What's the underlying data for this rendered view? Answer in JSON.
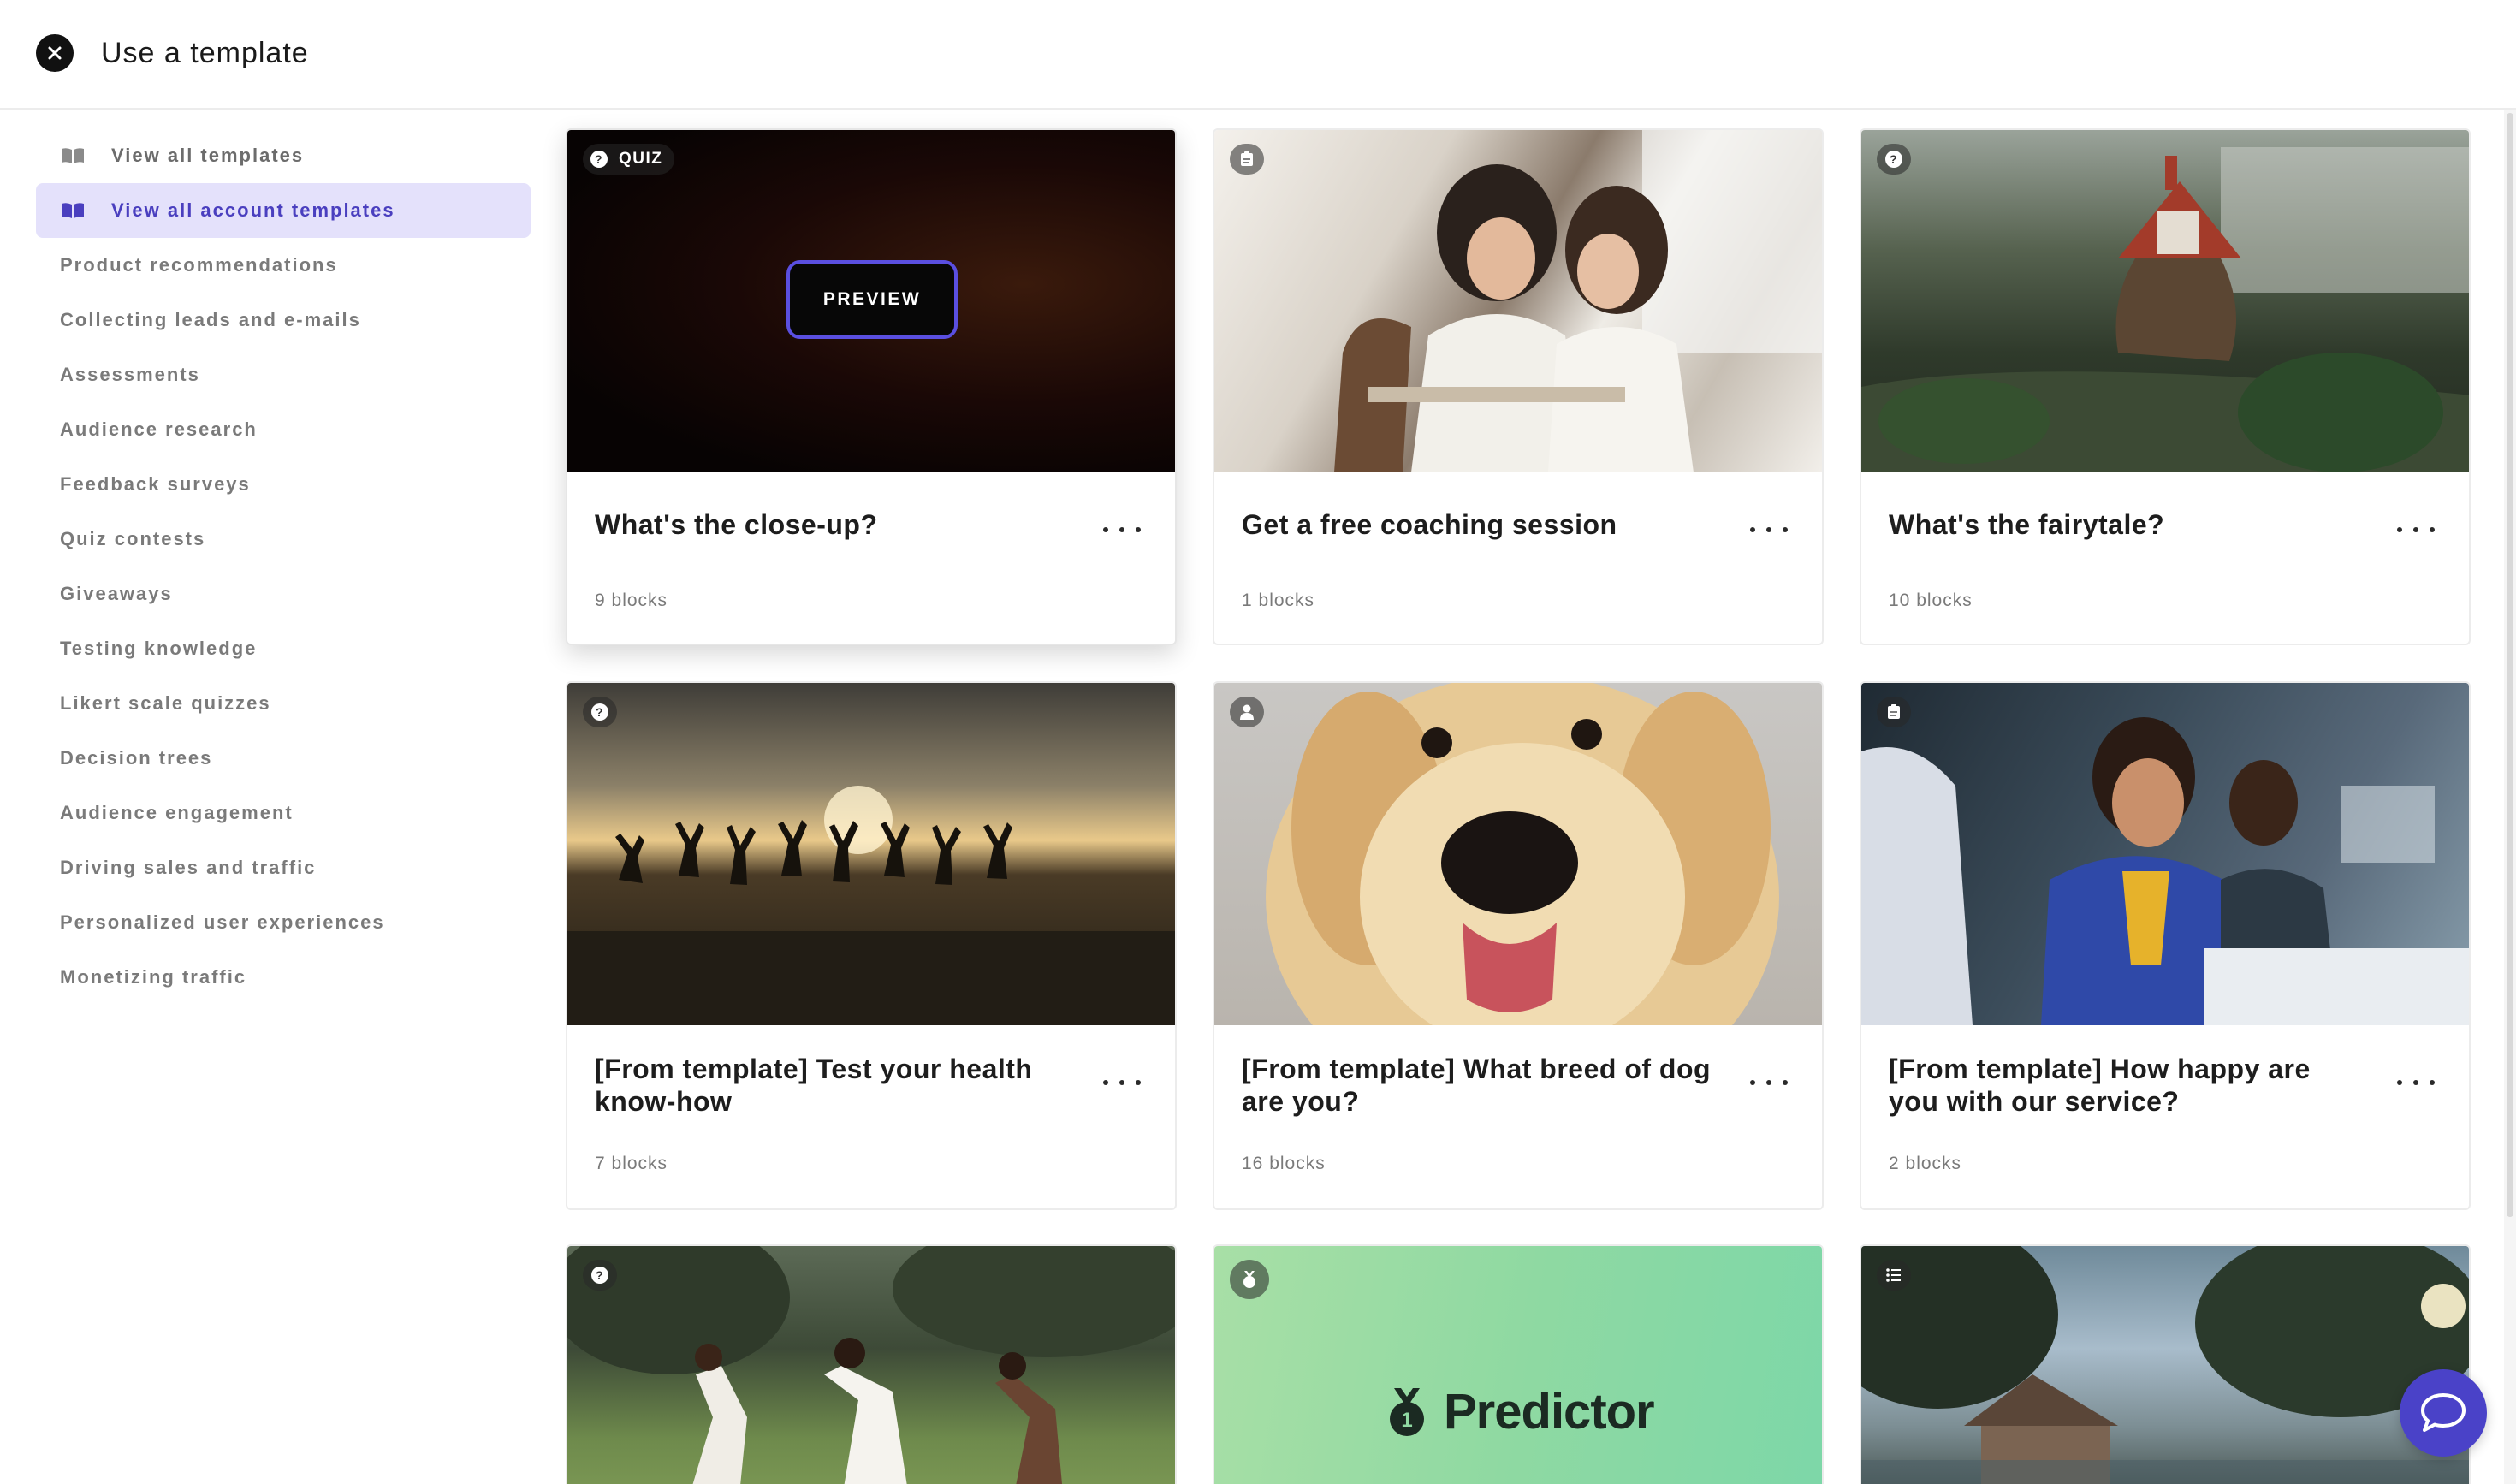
{
  "header": {
    "title": "Use a template"
  },
  "sidebar": {
    "items": [
      {
        "label": "View all templates"
      },
      {
        "label": "View all account templates"
      },
      {
        "label": "Product recommendations"
      },
      {
        "label": "Collecting leads and e-mails"
      },
      {
        "label": "Assessments"
      },
      {
        "label": "Audience research"
      },
      {
        "label": "Feedback surveys"
      },
      {
        "label": "Quiz contests"
      },
      {
        "label": "Giveaways"
      },
      {
        "label": "Testing knowledge"
      },
      {
        "label": "Likert scale quizzes"
      },
      {
        "label": "Decision trees"
      },
      {
        "label": "Audience engagement"
      },
      {
        "label": "Driving sales and traffic"
      },
      {
        "label": "Personalized user experiences"
      },
      {
        "label": "Monetizing traffic"
      }
    ]
  },
  "cards": [
    {
      "title": "What's the close-up?",
      "meta": "9 blocks",
      "badge": "QUIZ",
      "badge_icon": "question-icon",
      "preview_label": "PREVIEW"
    },
    {
      "title": "Get a free coaching session",
      "meta": "1 blocks",
      "badge_icon": "form-icon"
    },
    {
      "title": "What's the fairytale?",
      "meta": "10 blocks",
      "badge_icon": "question-icon"
    },
    {
      "title": "[From template] Test your health know-how",
      "meta": "7 blocks",
      "badge_icon": "question-icon"
    },
    {
      "title": "[From template] What breed of dog are you?",
      "meta": "16 blocks",
      "badge_icon": "person-icon"
    },
    {
      "title": "[From template] How happy are you with our service?",
      "meta": "2 blocks",
      "badge_icon": "form-icon"
    },
    {
      "title": "",
      "meta": "",
      "badge_icon": "question-icon"
    },
    {
      "title": "",
      "meta": "",
      "badge_icon": "medal-icon",
      "image_text": "Predictor"
    },
    {
      "title": "",
      "meta": "",
      "badge_icon": "list-icon"
    }
  ],
  "colors": {
    "accent": "#4a42c8",
    "active_bg": "#e4e1fb",
    "active_text": "#4a3fbf"
  }
}
